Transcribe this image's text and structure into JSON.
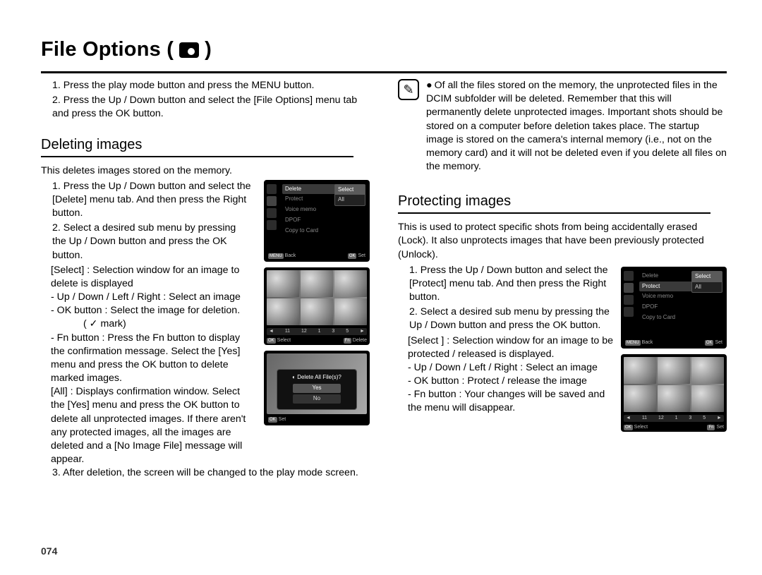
{
  "page": {
    "title_prefix": "File Options (",
    "title_suffix": ")",
    "page_number": "074"
  },
  "intro": {
    "step1": "1. Press the play mode button and press the MENU button.",
    "step2": "2. Press the Up / Down button and select the [File Options] menu tab and press the OK button."
  },
  "deleting": {
    "heading": "Deleting images",
    "intro": "This deletes images stored on the memory.",
    "step1": "1. Press the Up / Down button and select the [Delete] menu tab. And then press the Right button.",
    "step2": "2. Select a desired sub menu by pressing the Up / Down button and press the OK button.",
    "select_label": "[Select] : Selection window for an image to delete is displayed",
    "nav_line": "- Up / Down / Left / Right : Select an image",
    "ok_line_a": "- OK button : Select the image for deletion.",
    "ok_line_b": "( ✓ mark)",
    "fn_line_a": "- Fn button : Press the Fn button to display the confirmation message. Select the [Yes] menu and press the OK button to delete marked images.",
    "all_line": "[All] : Displays confirmation window. Select the [Yes] menu and press the OK button to delete all unprotected images. If there aren't any protected images, all the images are deleted and a [No Image File] message will appear.",
    "step3": "3. After deletion, the screen will be changed to the play mode screen."
  },
  "note": {
    "text": "Of all the files stored on the memory, the unprotected files in the DCIM subfolder will be deleted. Remember that this will permanently delete unprotected images. Important shots should be stored on a computer before deletion takes place. The startup image is stored on the camera's internal memory (i.e., not on the memory card) and it will not be deleted even if you delete all files on the memory."
  },
  "protecting": {
    "heading": "Protecting images",
    "intro": "This is used to protect specific shots from being accidentally erased (Lock). It also unprotects images that have been previously protected (Unlock).",
    "step1": "1. Press the Up / Down button and select the [Protect] menu tab. And then press the Right button.",
    "step2": "2. Select a desired sub menu by pressing the Up / Down button and press the OK button.",
    "select_label": "[Select ] : Selection window for an image to be protected / released is displayed.",
    "nav_line": "- Up / Down / Left / Right : Select an image",
    "ok_line": "- OK button : Protect / release the image",
    "fn_line": "- Fn button : Your changes will be saved and the menu will disappear."
  },
  "cam_delete_menu": {
    "items": [
      "Delete",
      "Protect",
      "Voice memo",
      "DPOF",
      "Copy to Card"
    ],
    "popup": [
      "Select",
      "All"
    ],
    "footer_left": "Back",
    "footer_right": "Set",
    "footer_left_key": "MENU",
    "footer_right_key": "OK"
  },
  "cam_thumbs_delete": {
    "strip": [
      "◄",
      "11",
      "12",
      "1",
      "3",
      "5",
      "►"
    ],
    "footer_left_key": "OK",
    "footer_left": "Select",
    "footer_right_key": "Fn",
    "footer_right": "Delete"
  },
  "cam_confirm": {
    "question": "Delete All File(s)?",
    "yes": "Yes",
    "no": "No",
    "footer_key": "OK",
    "footer": "Set"
  },
  "cam_protect_menu": {
    "items": [
      "Delete",
      "Protect",
      "Voice memo",
      "DPOF",
      "Copy to Card"
    ],
    "popup": [
      "Select",
      "All"
    ],
    "footer_left": "Back",
    "footer_right": "Set",
    "footer_left_key": "MENU",
    "footer_right_key": "OK"
  },
  "cam_thumbs_protect": {
    "strip": [
      "◄",
      "11",
      "12",
      "1",
      "3",
      "5",
      "►"
    ],
    "footer_left_key": "OK",
    "footer_left": "Select",
    "footer_right_key": "Fn",
    "footer_right": "Set"
  }
}
